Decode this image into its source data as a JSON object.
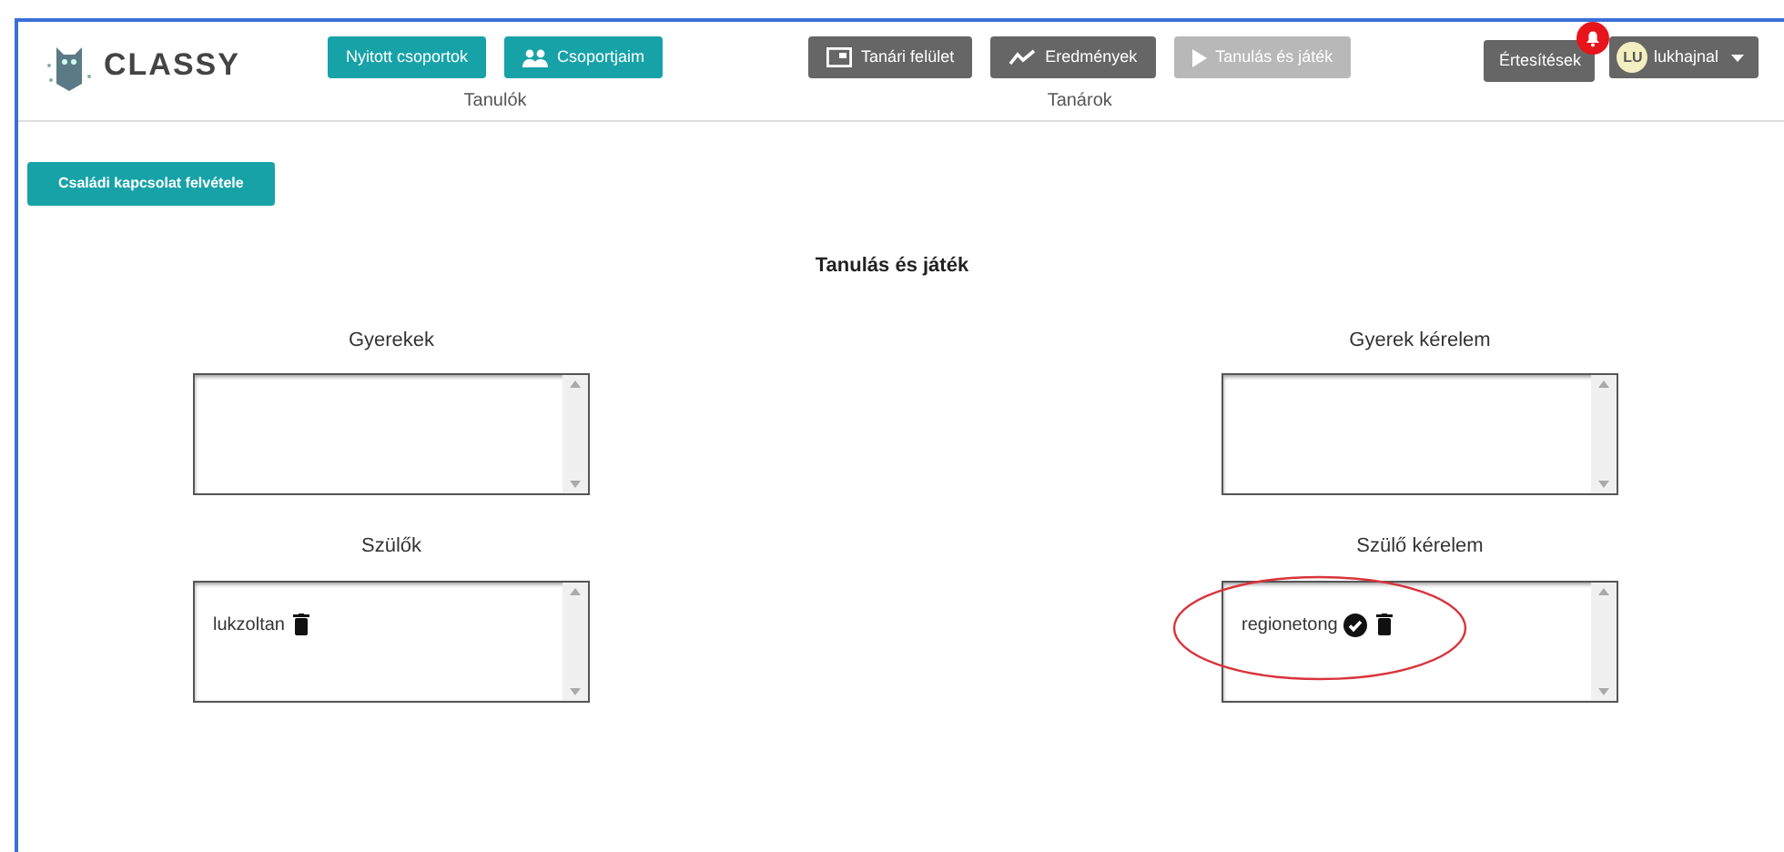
{
  "logo": {
    "name": "CLASSY"
  },
  "nav_groups": [
    {
      "caption": "Tanulók",
      "buttons": [
        {
          "label": "Nyitott csoportok",
          "kind": "plain",
          "disabled": false
        },
        {
          "label": "Csoportjaim",
          "kind": "users",
          "disabled": false
        }
      ]
    },
    {
      "caption": "Tanárok",
      "buttons": [
        {
          "label": "Tanári felület",
          "kind": "board",
          "disabled": false
        },
        {
          "label": "Eredmények",
          "kind": "chart",
          "disabled": false
        },
        {
          "label": "Tanulás és játék",
          "kind": "play",
          "disabled": true
        }
      ]
    }
  ],
  "notifications": {
    "label": "Értesítések",
    "alert": true
  },
  "user": {
    "initials": "LU",
    "name": "lukhajnal"
  },
  "add_button": "Családi kapcsolat felvétele",
  "page_title": "Tanulás és játék",
  "panels": [
    {
      "title": "Gyerekek"
    },
    {
      "title": "Gyerek kérelem"
    },
    {
      "title": "Szülők",
      "items": [
        {
          "name": "lukzoltan",
          "kind": "member"
        }
      ]
    },
    {
      "title": "Szülő kérelem",
      "items": [
        {
          "name": "regionetong",
          "kind": "request"
        }
      ],
      "circled": true
    }
  ]
}
